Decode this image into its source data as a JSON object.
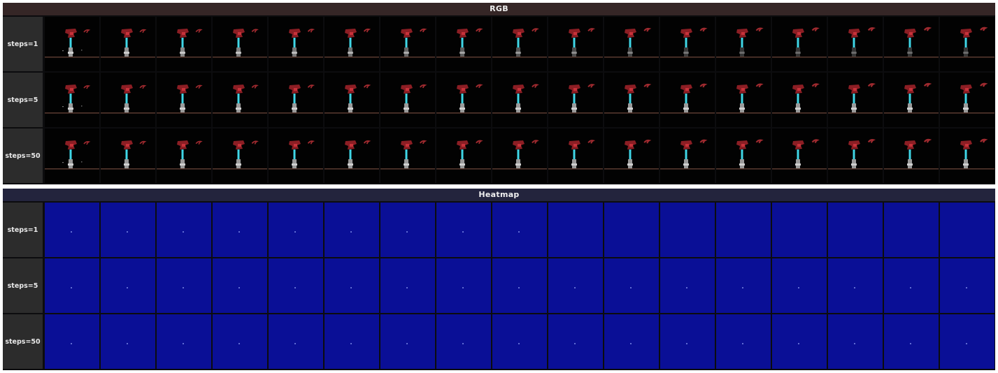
{
  "panels": {
    "rgb": {
      "title": "RGB",
      "rows": [
        {
          "label": "steps=1"
        },
        {
          "label": "steps=5"
        },
        {
          "label": "steps=50"
        }
      ]
    },
    "heatmap": {
      "title": "Heatmap",
      "rows": [
        {
          "label": "steps=1"
        },
        {
          "label": "steps=5"
        },
        {
          "label": "steps=50"
        }
      ]
    }
  },
  "colors": {
    "rgb_header": "#352626",
    "heatmap_header": "#23243d",
    "label_bg": "#2c2c2c",
    "rgb_cell_bg": "#020202",
    "heatmap_cell_bg": "#0a0f96",
    "robot_red": "#8c1e24",
    "robot_cyan": "#3fd6e6",
    "robot_gray": "#9a9a9a",
    "heat_dot": "#9fb0ff"
  },
  "frames_per_row": 17
}
